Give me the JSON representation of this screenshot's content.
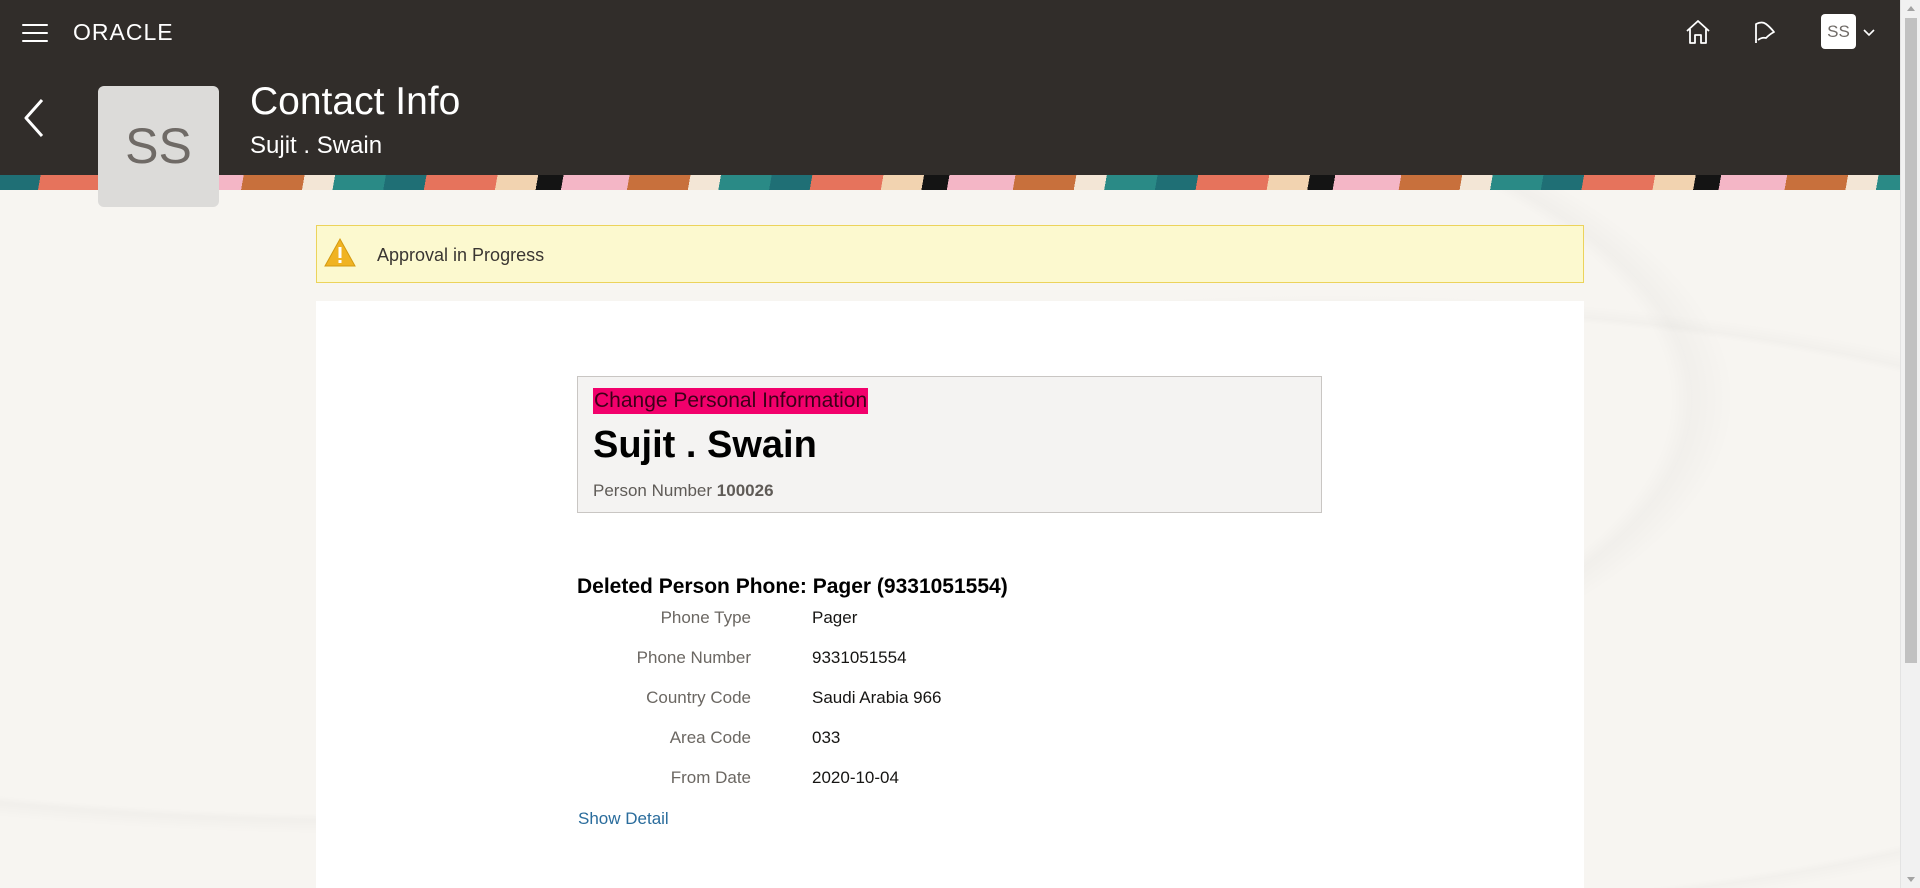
{
  "header": {
    "brand": "ORACLE",
    "user_initials": "SS",
    "page_title": "Contact Info",
    "page_subtitle": "Sujit . Swain"
  },
  "banner": {
    "message": "Approval in Progress"
  },
  "summary": {
    "tag": "Change Personal Information",
    "name": "Sujit . Swain",
    "person_number_label": "Person Number",
    "person_number": "100026"
  },
  "section": {
    "title": "Deleted Person Phone: Pager (9331051554)",
    "fields": [
      {
        "label": "Phone Type",
        "value": "Pager"
      },
      {
        "label": "Phone Number",
        "value": "9331051554"
      },
      {
        "label": "Country Code",
        "value": "Saudi Arabia 966"
      },
      {
        "label": "Area Code",
        "value": "033"
      },
      {
        "label": "From Date",
        "value": "2020-10-04"
      }
    ],
    "show_detail": "Show Detail"
  },
  "colors": {
    "topbar": "#312d2a",
    "highlight": "#f2006c",
    "banner_bg": "#fcf9cf",
    "link": "#2a6c9c"
  },
  "icons": [
    "hamburger-menu-icon",
    "home-icon",
    "tasks-flag-icon",
    "chevron-down-icon",
    "back-arrow-icon",
    "warning-icon"
  ]
}
